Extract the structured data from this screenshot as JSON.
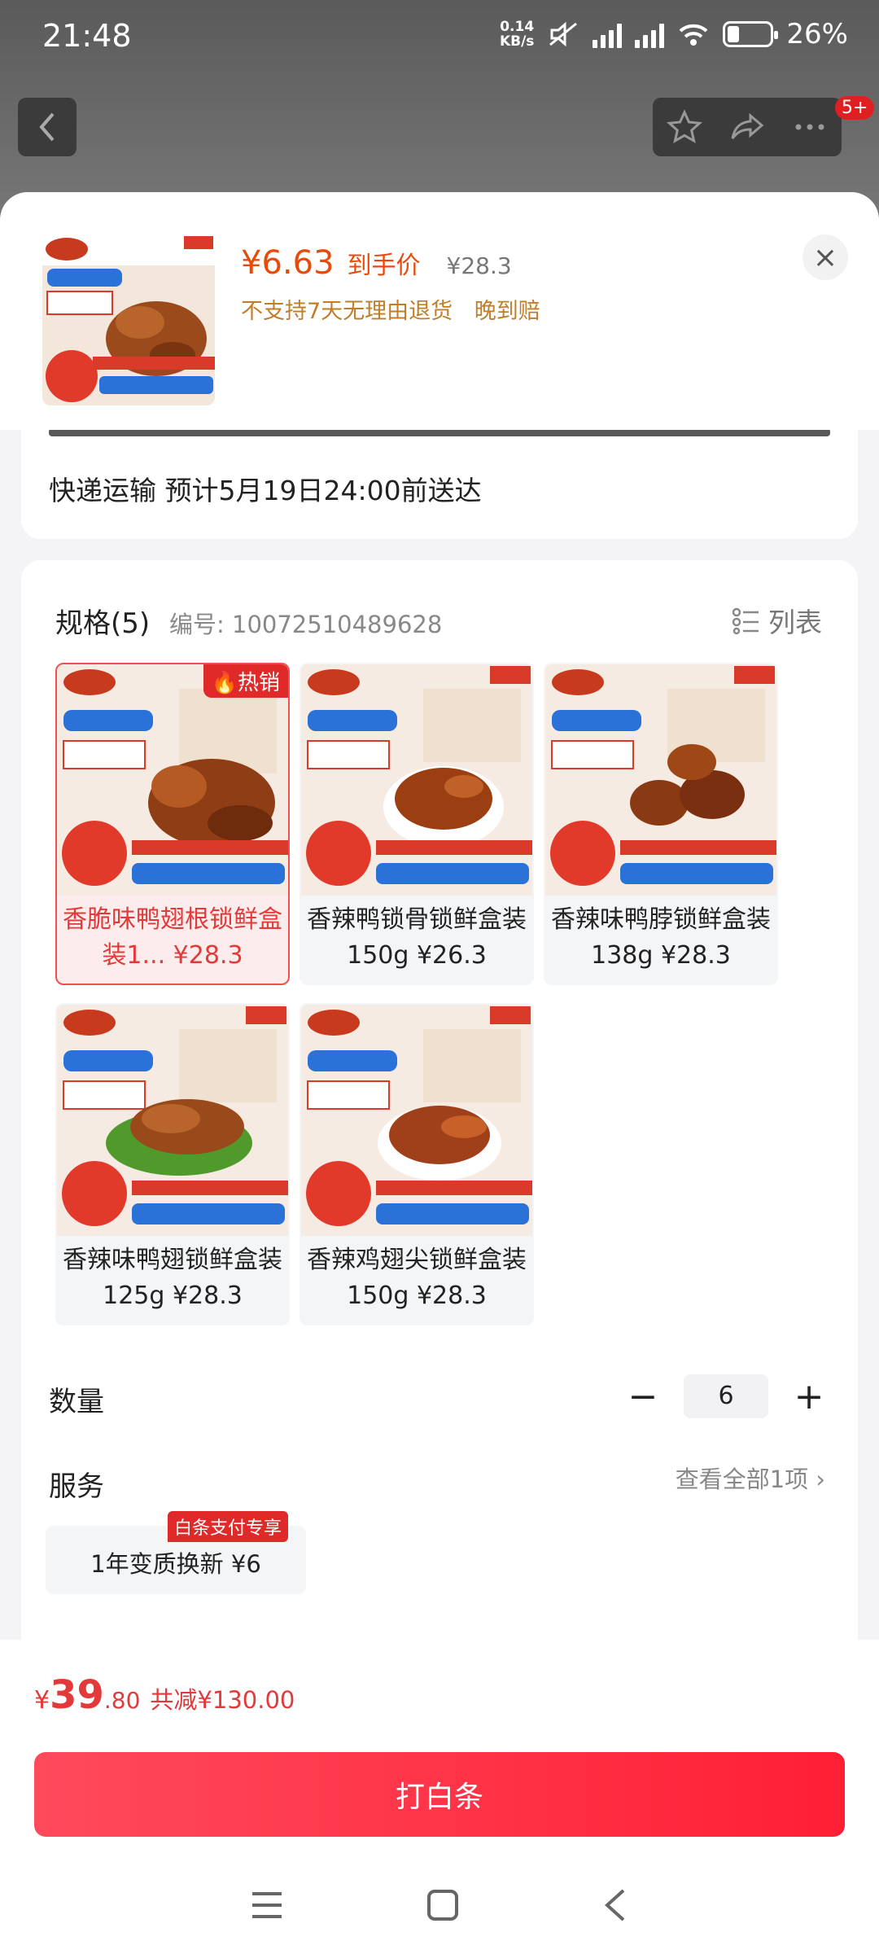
{
  "status_bar": {
    "time": "21:48",
    "net_speed_value": "0.14",
    "net_speed_unit": "KB/s",
    "battery": "26%"
  },
  "top_bar": {
    "badge": "5+"
  },
  "header": {
    "price": "¥6.63",
    "price_label": "到手价",
    "original_price": "¥28.3",
    "policy_no_return": "不支持7天无理由退货",
    "policy_late": "晚到赔"
  },
  "delivery": {
    "text": "快递运输 预计5月19日24:00前送达"
  },
  "spec": {
    "title": "规格(5)",
    "code": "编号: 10072510489628",
    "list_label": "列表",
    "items": [
      {
        "label": "香脆味鸭翅根锁鲜盒装1... ¥28.3",
        "hot": "热销",
        "selected": true
      },
      {
        "label": "香辣鸭锁骨锁鲜盒装150g ¥26.3",
        "selected": false
      },
      {
        "label": "香辣味鸭脖锁鲜盒装138g ¥28.3",
        "selected": false
      },
      {
        "label": "香辣味鸭翅锁鲜盒装125g ¥28.3",
        "selected": false
      },
      {
        "label": "香辣鸡翅尖锁鲜盒装150g ¥28.3",
        "selected": false
      }
    ]
  },
  "quantity": {
    "label": "数量",
    "value": "6",
    "minus": "−",
    "plus": "+"
  },
  "service": {
    "label": "服务",
    "view_all": "查看全部1项",
    "chip_text": "1年变质换新 ¥6",
    "chip_tag": "白条支付专享"
  },
  "footer": {
    "yen": "¥",
    "total_int": "39",
    "total_dec": ".80",
    "savings": "共减¥130.00",
    "pay_button": "打白条"
  },
  "colors": {
    "accent_red": "#ff1f35",
    "price_orange": "#e84a0a",
    "policy_gold": "#c07e2a"
  }
}
